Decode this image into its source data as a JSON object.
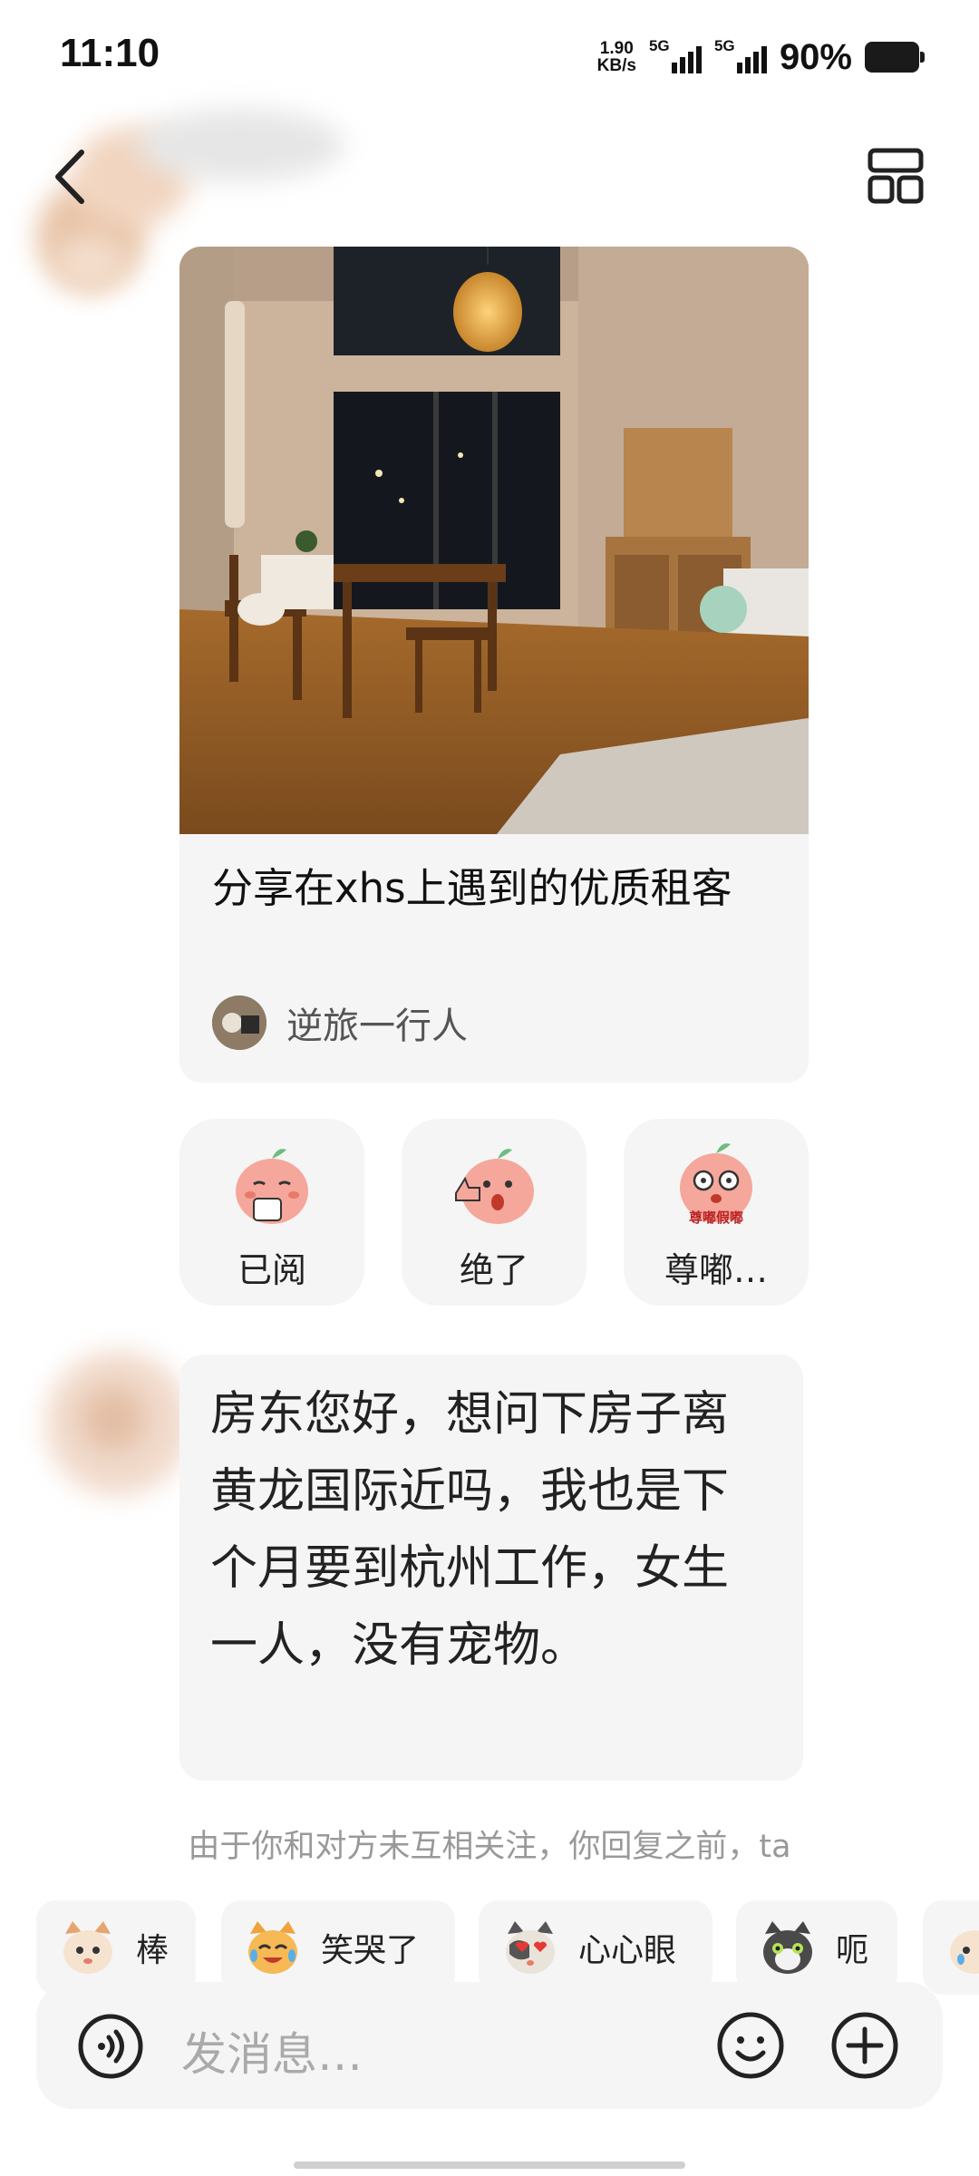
{
  "status_bar": {
    "time": "11:10",
    "net_speed_value": "1.90",
    "net_speed_unit": "KB/s",
    "signal_1": "5G",
    "signal_2": "5G",
    "battery": "90%"
  },
  "header": {
    "back_icon": "chevron-left-icon",
    "layout_icon": "grid-layout-icon"
  },
  "shared_card": {
    "title": "分享在xhs上遇到的优质租客",
    "author": "逆旅一行人"
  },
  "quick_reactions": [
    {
      "label": "已阅",
      "icon": "peach-tea-sticker"
    },
    {
      "label": "绝了",
      "icon": "peach-thumbs-up-sticker"
    },
    {
      "label": "尊嘟…",
      "icon": "peach-surprised-sticker",
      "sticker_text": "尊嘟假嘟"
    }
  ],
  "message": {
    "text": "房东您好，想问下房子离黄龙国际近吗，我也是下个月要到杭州工作，女生一人，没有宠物。"
  },
  "notice": {
    "text": "由于你和对方未互相关注，你回复之前，ta"
  },
  "sticker_suggestions": [
    {
      "label": "棒",
      "icon": "cat-thumbs-up-sticker"
    },
    {
      "label": "笑哭了",
      "icon": "cat-laugh-cry-sticker"
    },
    {
      "label": "心心眼",
      "icon": "cat-heart-eyes-sticker"
    },
    {
      "label": "呃",
      "icon": "cat-awkward-sticker"
    }
  ],
  "input_bar": {
    "placeholder": "发消息…",
    "voice_icon": "voice-icon",
    "emoji_icon": "emoji-icon",
    "plus_icon": "plus-icon"
  },
  "colors": {
    "bubble_bg": "#f5f5f5",
    "text": "#222222",
    "muted_text": "#999999"
  }
}
